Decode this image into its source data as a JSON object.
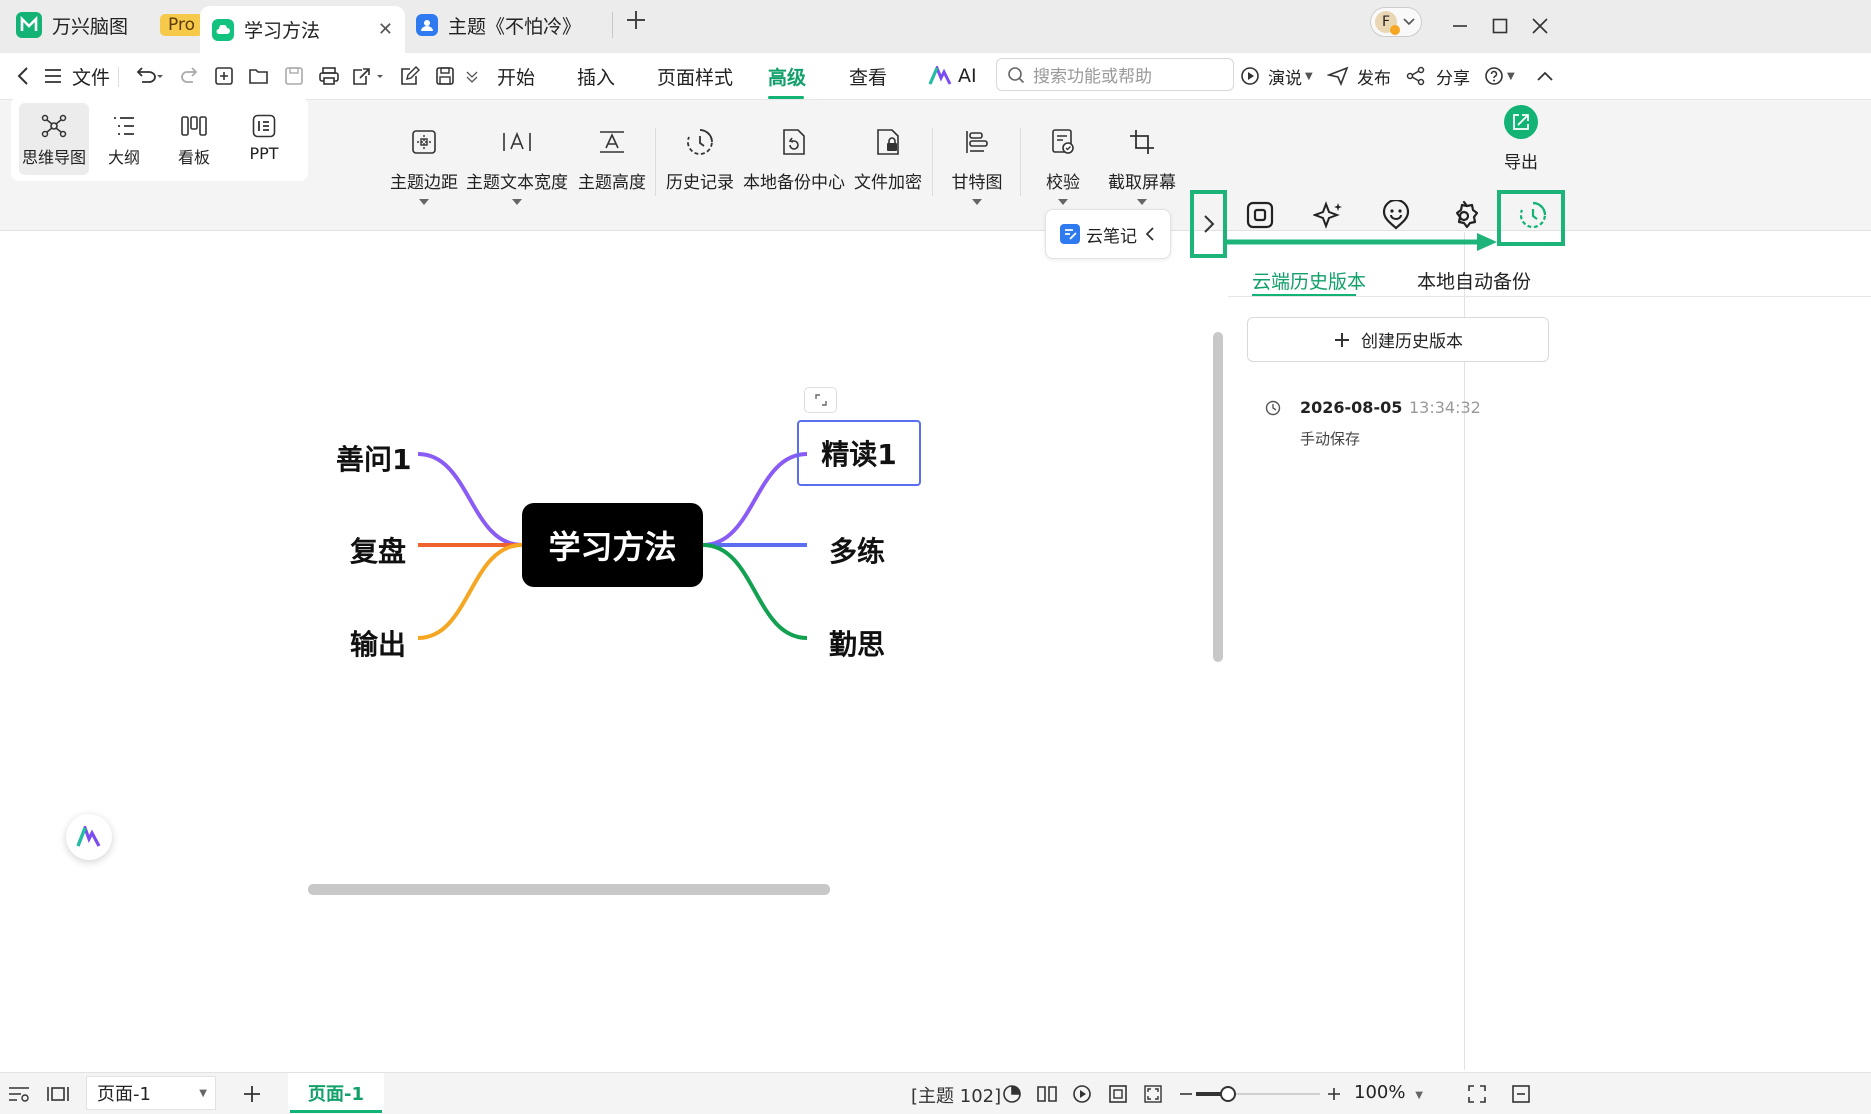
{
  "tabs": {
    "app": {
      "label": "万兴脑图",
      "badge": "Pro"
    },
    "doc1": {
      "label": "学习方法"
    },
    "doc2": {
      "label": "主题《不怕冷》"
    },
    "avatar_letter": "F"
  },
  "menubar": {
    "file": "文件",
    "tabs": [
      "开始",
      "插入",
      "页面样式",
      "高级",
      "查看",
      "AI"
    ],
    "active_tab": "高级",
    "search_placeholder": "搜索功能或帮助",
    "present": "演说",
    "publish": "发布",
    "share": "分享"
  },
  "ribbon": {
    "views": [
      "思维导图",
      "大纲",
      "看板",
      "PPT"
    ],
    "tools": [
      "主题边距",
      "主题文本宽度",
      "主题高度",
      "历史记录",
      "本地备份中心",
      "文件加密",
      "甘特图",
      "校验",
      "截取屏幕"
    ],
    "export": "导出"
  },
  "mindmap": {
    "root": "学习方法",
    "left": [
      "善问1",
      "复盘",
      "输出"
    ],
    "right": [
      "精读1",
      "多练",
      "勤思"
    ],
    "cloud_note": "云笔记"
  },
  "panel": {
    "tabs": [
      "云端历史版本",
      "本地自动备份"
    ],
    "create_button": "创建历史版本",
    "history": [
      {
        "date": "2026-08-05",
        "time": "13:34:32",
        "note": "手动保存"
      }
    ]
  },
  "status": {
    "page_select": "页面-1",
    "page_tab": "页面-1",
    "topic_count": "[主题 102]",
    "zoom": "100%"
  },
  "colors": {
    "accent": "#12b374",
    "highlight": "#1db47a",
    "branch_purple": "#8a5cf5",
    "branch_orange": "#f0622d",
    "branch_yellow": "#f5a623",
    "branch_blue": "#5b6df0",
    "branch_green": "#12a150"
  }
}
